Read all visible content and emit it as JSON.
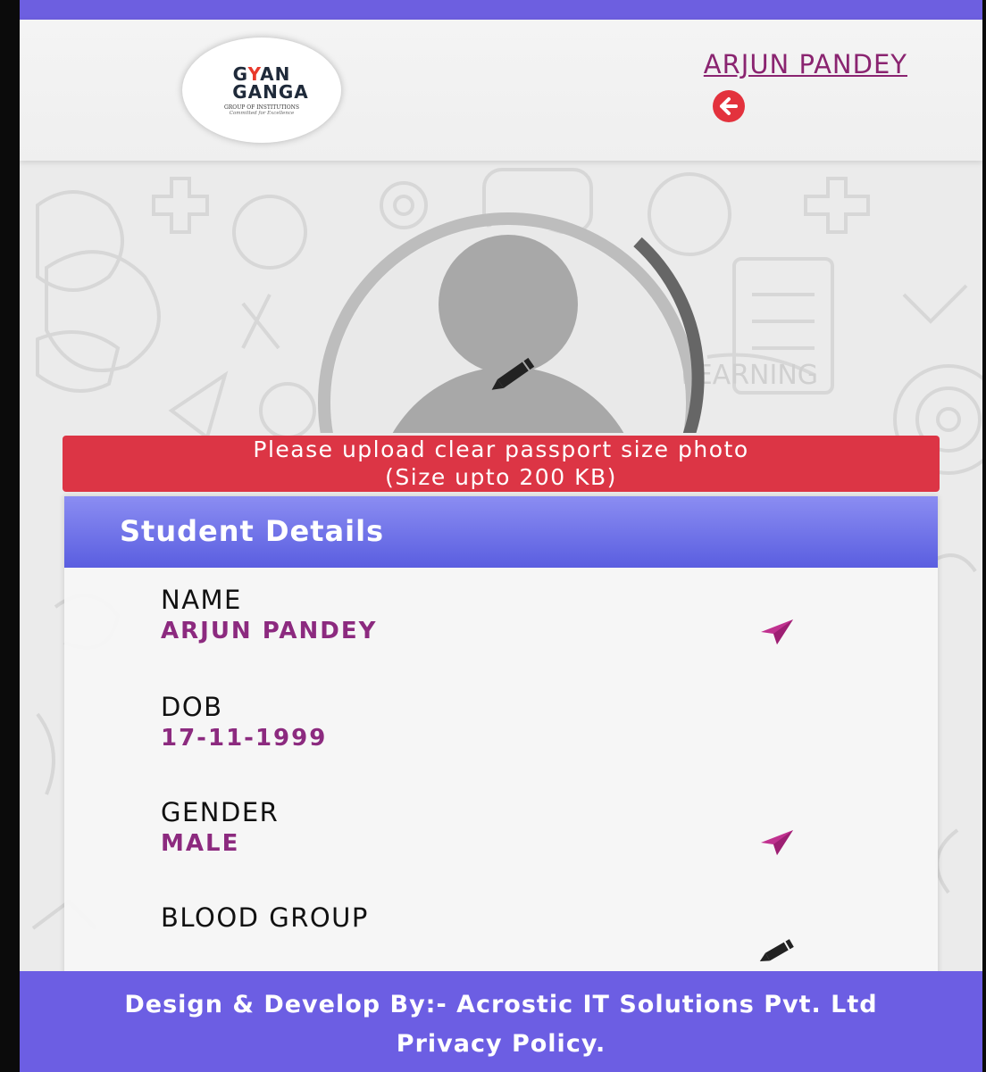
{
  "header": {
    "logo": {
      "line1_prefix": "G",
      "line1_y": "Y",
      "line1_suffix": "AN",
      "line2": "GANGA",
      "line3": "GROUP OF INSTITUTIONS",
      "line4": "Committed for Excellence"
    },
    "user_name": "ARJUN PANDEY",
    "back_icon": "arrow-left-circle-icon"
  },
  "photo": {
    "edit_icon": "pencil-icon",
    "notice_line1": "Please upload clear passport size photo",
    "notice_line2": "(Size upto 200 KB)"
  },
  "student_details": {
    "title": "Student Details",
    "fields": [
      {
        "label": "NAME",
        "value": "ARJUN PANDEY",
        "action_icon": "send-icon"
      },
      {
        "label": "DOB",
        "value": "17-11-1999"
      },
      {
        "label": "GENDER",
        "value": "MALE",
        "action_icon": "send-icon"
      },
      {
        "label": "BLOOD GROUP",
        "value": "",
        "action_icon": "pencil-icon"
      }
    ]
  },
  "footer": {
    "credit": "Design & Develop By:- Acrostic IT Solutions Pvt. Ltd",
    "privacy": "Privacy Policy."
  },
  "colors": {
    "accent": "#6c5ee3",
    "notice_red": "#dc3545",
    "value_purple": "#8c2a7f",
    "send_pink": "#c0318f"
  }
}
